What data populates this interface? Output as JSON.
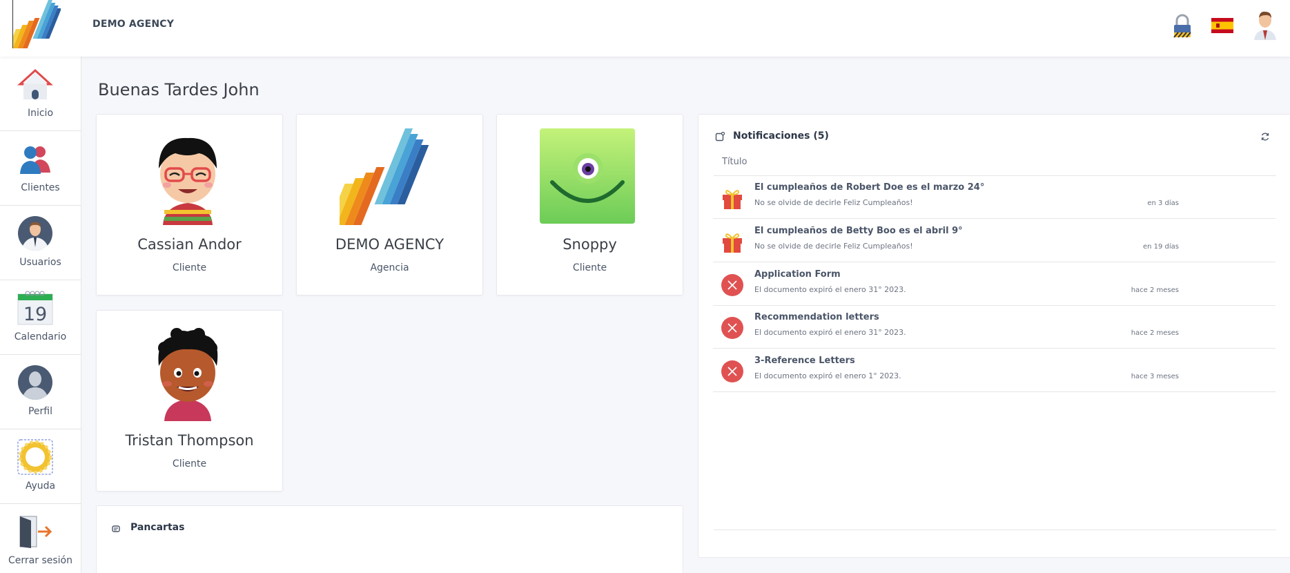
{
  "header": {
    "brand": "DEMO AGENCY",
    "icons": [
      "lock-icon",
      "spain-flag-icon",
      "user-avatar-icon"
    ]
  },
  "sidebar": {
    "items": [
      {
        "label": "Inicio",
        "icon": "home-icon"
      },
      {
        "label": "Clientes",
        "icon": "clients-icon"
      },
      {
        "label": "Usuarios",
        "icon": "users-icon"
      },
      {
        "label": "Calendario",
        "icon": "calendar-icon",
        "day": "19"
      },
      {
        "label": "Perfil",
        "icon": "profile-icon"
      },
      {
        "label": "Ayuda",
        "icon": "help-icon"
      },
      {
        "label": "Cerrar sesión",
        "icon": "logout-icon"
      }
    ]
  },
  "main": {
    "greeting": "Buenas Tardes John",
    "cards": [
      {
        "name": "Cassian Andor",
        "role": "Cliente"
      },
      {
        "name": "DEMO AGENCY",
        "role": "Agencia"
      },
      {
        "name": "Snoppy",
        "role": "Cliente"
      },
      {
        "name": "Tristan Thompson",
        "role": "Cliente"
      }
    ],
    "banners_title": "Pancartas"
  },
  "notifications": {
    "title": "Notificaciones (5)",
    "column": "Título",
    "items": [
      {
        "title": "El cumpleaños de Robert Doe es el marzo 24°",
        "sub": "No se olvide de decirle Feliz Cumpleaños!",
        "time": "en 3 días",
        "icon": "gift-icon"
      },
      {
        "title": "El cumpleaños de Betty Boo es el abril 9°",
        "sub": "No se olvide de decirle Feliz Cumpleaños!",
        "time": "en 19 días",
        "icon": "gift-icon"
      },
      {
        "title": "Application Form",
        "sub": "El documento expiró el enero 31° 2023.",
        "time": "hace 2 meses",
        "icon": "expired-icon"
      },
      {
        "title": "Recommendation letters",
        "sub": "El documento expiró el enero 31° 2023.",
        "time": "hace 2 meses",
        "icon": "expired-icon"
      },
      {
        "title": "3-Reference Letters",
        "sub": "El documento expiró el enero 1° 2023.",
        "time": "hace 3 meses",
        "icon": "expired-icon"
      }
    ]
  },
  "colors": {
    "accent": "#e05252",
    "brand_orange": "#e8742c",
    "brand_blue": "#3a7fc6"
  }
}
